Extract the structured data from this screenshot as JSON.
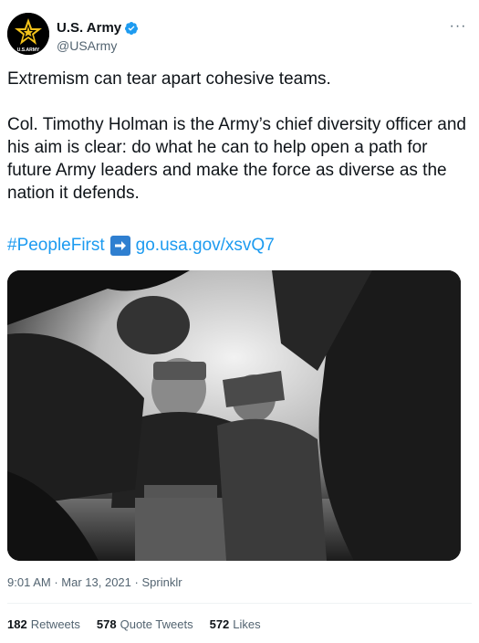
{
  "account": {
    "display_name": "U.S. Army",
    "handle": "@USArmy",
    "avatar_text": "U.S.ARMY"
  },
  "menu": {
    "more_label": "···"
  },
  "tweet": {
    "text": "Extremism can tear apart cohesive teams.\n\nCol. Timothy Holman is the Army’s chief diversity officer and his aim is clear: do what he can to help open a path for future Army leaders and make the force as diverse as the nation it defends.",
    "hashtag": "#PeopleFirst",
    "link": "go.usa.gov/xsvQ7"
  },
  "meta": {
    "time": "9:01 AM",
    "date": "Mar 13, 2021",
    "source": "Sprinklr"
  },
  "stats": {
    "retweets_count": "182",
    "retweets_label": "Retweets",
    "quote_count": "578",
    "quote_label": "Quote Tweets",
    "likes_count": "572",
    "likes_label": "Likes"
  },
  "colors": {
    "link": "#1d9bf0",
    "verified": "#1d9bf0",
    "muted": "#536471",
    "army_gold": "#f2c21b"
  },
  "icons": [
    "army-star-logo",
    "verified-badge-icon",
    "more-options-icon",
    "right-arrow-emoji-icon"
  ]
}
